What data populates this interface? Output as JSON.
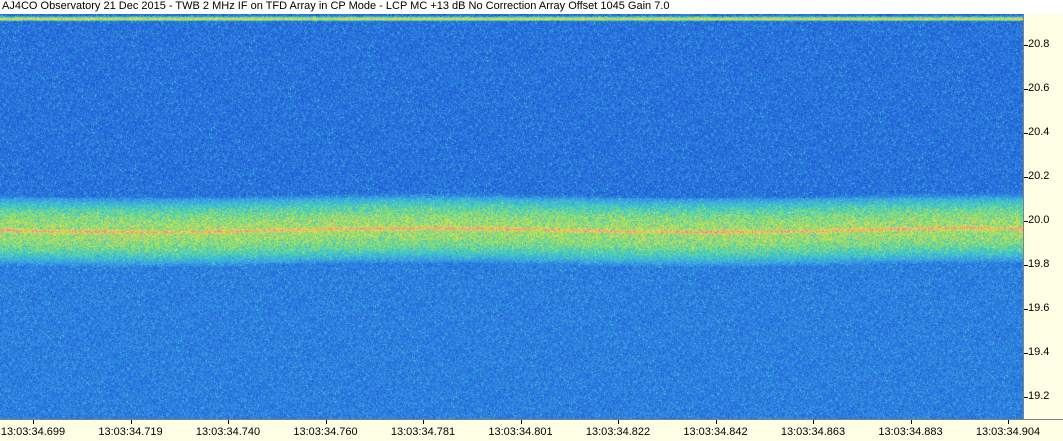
{
  "header": {
    "title": "AJ4CO Observatory 21 Dec 2015 - TWB 2 MHz IF on TFD Array in CP Mode - LCP  MC +13 dB  No Correction Array  Offset 1045  Gain 7.0"
  },
  "chart_data": {
    "type": "heatmap",
    "title": "AJ4CO Observatory 21 Dec 2015 - TWB 2 MHz IF on TFD Array in CP Mode - LCP  MC +13 dB  No Correction Array  Offset 1045  Gain 7.0",
    "x": {
      "tick_labels": [
        "13:03:34.699",
        "13:03:34.719",
        "13:03:34.740",
        "13:03:34.760",
        "13:03:34.781",
        "13:03:34.801",
        "13:03:34.822",
        "13:03:34.842",
        "13:03:34.863",
        "13:03:34.883",
        "13:03:34.904"
      ]
    },
    "y": {
      "tick_labels": [
        "20.8",
        "20.6",
        "20.4",
        "20.2",
        "20.0",
        "19.8",
        "19.6",
        "19.4",
        "19.2"
      ],
      "ylim": [
        19.1,
        20.94
      ]
    },
    "features": [
      {
        "kind": "interference_line",
        "y": 20.92
      },
      {
        "kind": "emission_band",
        "y_low": 19.86,
        "y_high": 20.06,
        "peak_y": 19.96
      }
    ],
    "colormap": [
      "#1030a0",
      "#1e5cd6",
      "#3aa0e8",
      "#40d0c0",
      "#a0e060",
      "#f0e040",
      "#ff70b0"
    ]
  }
}
